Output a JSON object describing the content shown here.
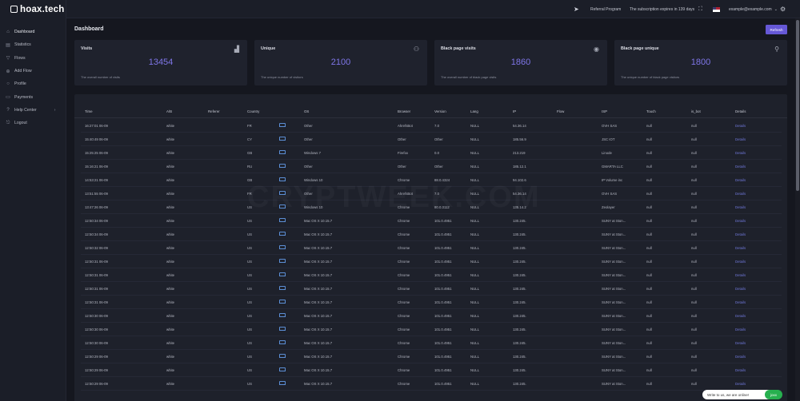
{
  "app": {
    "logo_text": "hoax.tech"
  },
  "sidebar": {
    "items": [
      {
        "label": "Dashboard",
        "icon": "home-icon"
      },
      {
        "label": "Statistics",
        "icon": "chart-icon"
      },
      {
        "label": "Flows",
        "icon": "filter-icon"
      },
      {
        "label": "Add Flow",
        "icon": "plus-icon"
      },
      {
        "label": "Profile",
        "icon": "user-icon"
      },
      {
        "label": "Payments",
        "icon": "card-icon"
      },
      {
        "label": "Help Center",
        "icon": "help-icon"
      },
      {
        "label": "Logout",
        "icon": "logout-icon"
      }
    ]
  },
  "topbar": {
    "referral": "Referral Program",
    "subscription": "The subscription expires in 139 days",
    "email": "example@example.com",
    "icons": [
      "send-icon",
      "fullscreen-icon",
      "us-flag-icon",
      "gear-icon"
    ]
  },
  "main": {
    "title": "Dashboard",
    "refresh_label": "Refresh"
  },
  "cards": [
    {
      "title": "Visits",
      "value": "13454",
      "desc": "The overall number of visits",
      "icon": "bar-chart-icon"
    },
    {
      "title": "Unique",
      "value": "2100",
      "desc": "The unique number of visitors",
      "icon": "users-icon"
    },
    {
      "title": "Black page visits",
      "value": "1860",
      "desc": "The overall number of black page visits",
      "icon": "eye-icon"
    },
    {
      "title": "Black page unique",
      "value": "1800",
      "desc": "The unique number of black page visitors",
      "icon": "user-plus-icon"
    }
  ],
  "table": {
    "headers": [
      "Time",
      "A/B",
      "Referer",
      "Country",
      "OS",
      "Browser",
      "Version",
      "Lang",
      "IP",
      "Flow",
      "ISP",
      "Touch",
      "is_bot",
      "Details"
    ],
    "rows": [
      [
        "16:27:01 06-09",
        "white",
        "",
        "FR",
        "Other",
        "AhrefsBot",
        "7.0",
        "NULL",
        "54.36.14",
        "",
        "OVH SAS",
        "null",
        "null",
        "Details"
      ],
      [
        "15:40:49 06-09",
        "white",
        "",
        "CY",
        "Other",
        "Other",
        "Other",
        "NULL",
        "185.56.9",
        "",
        "JSC IOT",
        "null",
        "null",
        "Details"
      ],
      [
        "15:25:25 06-09",
        "white",
        "",
        "GB",
        "Windows 7",
        "Firefox",
        "0.0",
        "NULL",
        "213.219",
        "",
        "Linode",
        "null",
        "null",
        "Details"
      ],
      [
        "15:16:21 06-09",
        "white",
        "",
        "RU",
        "Other",
        "Other",
        "Other",
        "NULL",
        "185.12.1",
        "",
        "GMARTA LLC",
        "null",
        "null",
        "Details"
      ],
      [
        "14:53:21 06-09",
        "white",
        "",
        "GB",
        "Windows 10",
        "Chrome",
        "88.0.4324",
        "NULL",
        "94.102.6",
        "",
        "IP Volume inc",
        "null",
        "null",
        "Details"
      ],
      [
        "13:51:55 06-09",
        "white",
        "",
        "FR",
        "Other",
        "AhrefsBot",
        "7.0",
        "NULL",
        "54.36.14",
        "",
        "OVH SAS",
        "null",
        "null",
        "Details"
      ],
      [
        "13:47:26 06-09",
        "white",
        "",
        "US",
        "Windows 10",
        "Chrome",
        "80.0.3112",
        "NULL",
        "135.14.2",
        "",
        "Zeolayer",
        "null",
        "null",
        "Details"
      ],
      [
        "12:50:34 06-09",
        "white",
        "",
        "US",
        "Mac OS X 10.15.7",
        "Chrome",
        "101.0.4951",
        "NULL",
        "130.245.",
        "",
        "SUNY at Ston...",
        "null",
        "null",
        "Details"
      ],
      [
        "12:50:34 06-09",
        "white",
        "",
        "US",
        "Mac OS X 10.15.7",
        "Chrome",
        "101.0.4951",
        "NULL",
        "130.245.",
        "",
        "SUNY at Ston...",
        "null",
        "null",
        "Details"
      ],
      [
        "12:50:32 06-09",
        "white",
        "",
        "US",
        "Mac OS X 10.15.7",
        "Chrome",
        "101.0.4951",
        "NULL",
        "130.245.",
        "",
        "SUNY at Ston...",
        "null",
        "null",
        "Details"
      ],
      [
        "12:50:31 06-09",
        "white",
        "",
        "US",
        "Mac OS X 10.15.7",
        "Chrome",
        "101.0.4951",
        "NULL",
        "130.245.",
        "",
        "SUNY at Ston...",
        "null",
        "null",
        "Details"
      ],
      [
        "12:50:31 06-09",
        "white",
        "",
        "US",
        "Mac OS X 10.15.7",
        "Chrome",
        "101.0.4951",
        "NULL",
        "130.245.",
        "",
        "SUNY at Ston...",
        "null",
        "null",
        "Details"
      ],
      [
        "12:50:31 06-09",
        "white",
        "",
        "US",
        "Mac OS X 10.15.7",
        "Chrome",
        "101.0.4951",
        "NULL",
        "130.245.",
        "",
        "SUNY at Ston...",
        "null",
        "null",
        "Details"
      ],
      [
        "12:50:31 06-09",
        "white",
        "",
        "US",
        "Mac OS X 10.15.7",
        "Chrome",
        "101.0.4951",
        "NULL",
        "130.245.",
        "",
        "SUNY at Ston...",
        "null",
        "null",
        "Details"
      ],
      [
        "12:50:30 06-09",
        "white",
        "",
        "US",
        "Mac OS X 10.15.7",
        "Chrome",
        "101.0.4951",
        "NULL",
        "130.245.",
        "",
        "SUNY at Ston...",
        "null",
        "null",
        "Details"
      ],
      [
        "12:50:30 06-09",
        "white",
        "",
        "US",
        "Mac OS X 10.15.7",
        "Chrome",
        "101.0.4951",
        "NULL",
        "130.245.",
        "",
        "SUNY at Ston...",
        "null",
        "null",
        "Details"
      ],
      [
        "12:50:30 06-09",
        "white",
        "",
        "US",
        "Mac OS X 10.15.7",
        "Chrome",
        "101.0.4951",
        "NULL",
        "130.245.",
        "",
        "SUNY at Ston...",
        "null",
        "null",
        "Details"
      ],
      [
        "12:50:29 06-09",
        "white",
        "",
        "US",
        "Mac OS X 10.15.7",
        "Chrome",
        "101.0.4951",
        "NULL",
        "130.245.",
        "",
        "SUNY at Ston...",
        "null",
        "null",
        "Details"
      ],
      [
        "12:50:29 06-09",
        "white",
        "",
        "US",
        "Mac OS X 10.15.7",
        "Chrome",
        "101.0.4951",
        "NULL",
        "130.245.",
        "",
        "SUNY at Ston...",
        "null",
        "null",
        "Details"
      ],
      [
        "12:50:29 06-09",
        "white",
        "",
        "US",
        "Mac OS X 10.15.7",
        "Chrome",
        "101.0.4951",
        "NULL",
        "130.245.",
        "",
        "SUNY at Ston...",
        "null",
        "null",
        "Details"
      ]
    ]
  },
  "watermark": "CRYPTWEEK.COM",
  "chat": {
    "text": "Write to us, we are online!",
    "badge": "joxx"
  },
  "colors": {
    "accent": "#6658d6",
    "value": "#7f76e8",
    "link": "#6f78d8",
    "background": "#15171f",
    "panel": "#1f222d"
  }
}
